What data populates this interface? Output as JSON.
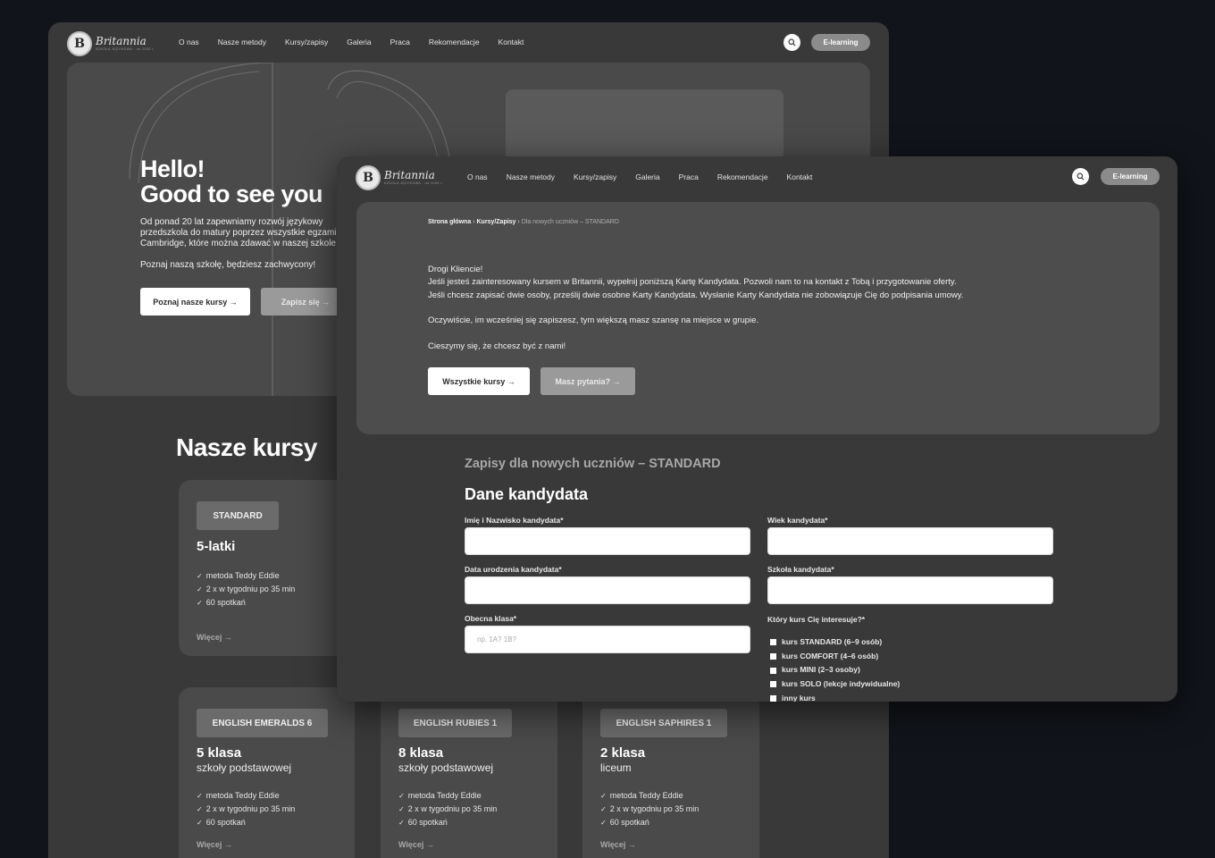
{
  "brand": {
    "name": "Britannia",
    "badge": "B",
    "tagline": "SZKOŁA JĘZYKOWA · od 2000 r."
  },
  "nav": {
    "items": [
      "O nas",
      "Nasze metody",
      "Kursy/zapisy",
      "Galeria",
      "Praca",
      "Rekomendacje",
      "Kontakt"
    ],
    "elearning": "E-learning"
  },
  "back": {
    "hero": {
      "title_line1": "Hello!",
      "title_line2": "Good to see you",
      "paragraph": "Od ponad 20 lat zapewniamy rozwój językowy\nprzedszkola do matury poprzez wszystkie egzaminy\nCambridge, które można zdawać w naszej szkole.",
      "paragraph2": "Poznaj naszą szkołę, będziesz zachwycony!",
      "btn_primary": "Poznaj nasze kursy →",
      "btn_secondary": "Zapisz się →"
    },
    "section_title": "Nasze kursy",
    "courses": [
      {
        "badge": "STANDARD",
        "title": "5-latki",
        "subtitle": "",
        "features": [
          "metoda Teddy Eddie",
          "2 x w tygodniu po 35 min",
          "60 spotkań"
        ],
        "more": "Więcej →"
      },
      {
        "badge": "ENGLISH EMERALDS 6",
        "title": "5 klasa",
        "subtitle": "szkoły podstawowej",
        "features": [
          "metoda Teddy Eddie",
          "2 x w tygodniu po 35 min",
          "60 spotkań"
        ],
        "more": "Więcej →"
      },
      {
        "badge": "ENGLISH RUBIES 1",
        "title": "8 klasa",
        "subtitle": "szkoły podstawowej",
        "features": [
          "metoda Teddy Eddie",
          "2 x w tygodniu po 35 min",
          "60 spotkań"
        ],
        "more": "Więcej →"
      },
      {
        "badge": "ENGLISH SAPHIRES 1",
        "title": "2 klasa",
        "subtitle": "liceum",
        "features": [
          "metoda Teddy Eddie",
          "2 x w tygodniu po 35 min",
          "60 spotkań"
        ],
        "more": "Więcej →"
      }
    ]
  },
  "front": {
    "breadcrumb": {
      "home": "Strona główna",
      "sep": "›",
      "section": "Kursy/Zapisy",
      "current": "Dla nowych uczniów – STANDARD"
    },
    "message": {
      "greeting": "Drogi Kliencie!",
      "line1": "Jeśli jesteś zainteresowany kursem w Britannii, wypełnij poniższą Kartę Kandydata. Pozwoli nam to na kontakt z Tobą i przygotowanie oferty.",
      "line2": "Jeśli chcesz zapisać dwie osoby, prześlij dwie osobne Karty Kandydata. Wysłanie Karty Kandydata nie zobowiązuje Cię do podpisania umowy.",
      "line3": "Oczywiście, im wcześniej się zapiszesz, tym większą masz szansę na miejsce w grupie.",
      "line4": "Cieszymy się, że chcesz być z nami!"
    },
    "btn_all_courses": "Wszystkie kursy →",
    "btn_questions": "Masz pytania? →",
    "form": {
      "subtitle": "Zapisy dla nowych uczniów – STANDARD",
      "heading": "Dane kandydata",
      "fields": {
        "name_label": "Imię i Nazwisko kandydata*",
        "age_label": "Wiek kandydata*",
        "dob_label": "Data urodzenia kandydata*",
        "school_label": "Szkoła kandydata*",
        "class_label": "Obecna klasa*",
        "class_placeholder": "np. 1A? 1B?",
        "course_label": "Który kurs Cię interesuje?*"
      },
      "course_options": [
        "kurs STANDARD (6–9 osób)",
        "kurs COMFORT (4–6 osób)",
        "kurs MINI (2–3 osoby)",
        "kurs SOLO (lekcje indywidualne)",
        "inny kurs"
      ]
    }
  }
}
